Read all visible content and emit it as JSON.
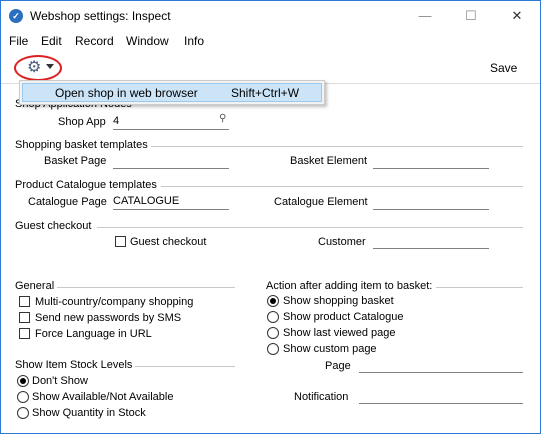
{
  "window": {
    "title": "Webshop settings: Inspect",
    "minimize_glyph": "—",
    "maximize_glyph": "☐",
    "close_glyph": "✕"
  },
  "menu": [
    "File",
    "Edit",
    "Record",
    "Window",
    "Info"
  ],
  "toolbar": {
    "save_label": "Save",
    "gear_icon": "gear-icon"
  },
  "dropdown": {
    "item_label": "Open shop in web browser",
    "item_shortcut": "Shift+Ctrl+W"
  },
  "sections": {
    "shop_app_nodes": {
      "title": "Shop Application Nodes",
      "shop_app_label": "Shop App",
      "shop_app_value": "4"
    },
    "basket": {
      "title": "Shopping basket templates",
      "basket_page_label": "Basket Page",
      "basket_page_value": "",
      "basket_element_label": "Basket Element",
      "basket_element_value": ""
    },
    "catalogue": {
      "title": "Product Catalogue templates",
      "catalogue_page_label": "Catalogue Page",
      "catalogue_page_value": "CATALOGUE",
      "catalogue_element_label": "Catalogue Element",
      "catalogue_element_value": ""
    },
    "guest": {
      "title": "Guest checkout",
      "guest_checkbox_label": "Guest checkout",
      "guest_checked": false,
      "customer_label": "Customer",
      "customer_value": ""
    },
    "general": {
      "title": "General",
      "items": [
        {
          "label": "Multi-country/company shopping",
          "checked": false
        },
        {
          "label": "Send new passwords by SMS",
          "checked": false
        },
        {
          "label": "Force Language in URL",
          "checked": false
        }
      ]
    },
    "after_add": {
      "title": "Action after adding item to basket:",
      "options": [
        {
          "label": "Show shopping basket",
          "selected": true
        },
        {
          "label": "Show product Catalogue",
          "selected": false
        },
        {
          "label": "Show last viewed page",
          "selected": false
        },
        {
          "label": "Show custom page",
          "selected": false
        }
      ],
      "page_label": "Page",
      "page_value": "",
      "notification_label": "Notification",
      "notification_value": ""
    },
    "stock": {
      "title": "Show Item Stock Levels",
      "options": [
        {
          "label": "Don't Show",
          "selected": true
        },
        {
          "label": "Show Available/Not Available",
          "selected": false
        },
        {
          "label": "Show Quantity in Stock",
          "selected": false
        }
      ]
    }
  }
}
